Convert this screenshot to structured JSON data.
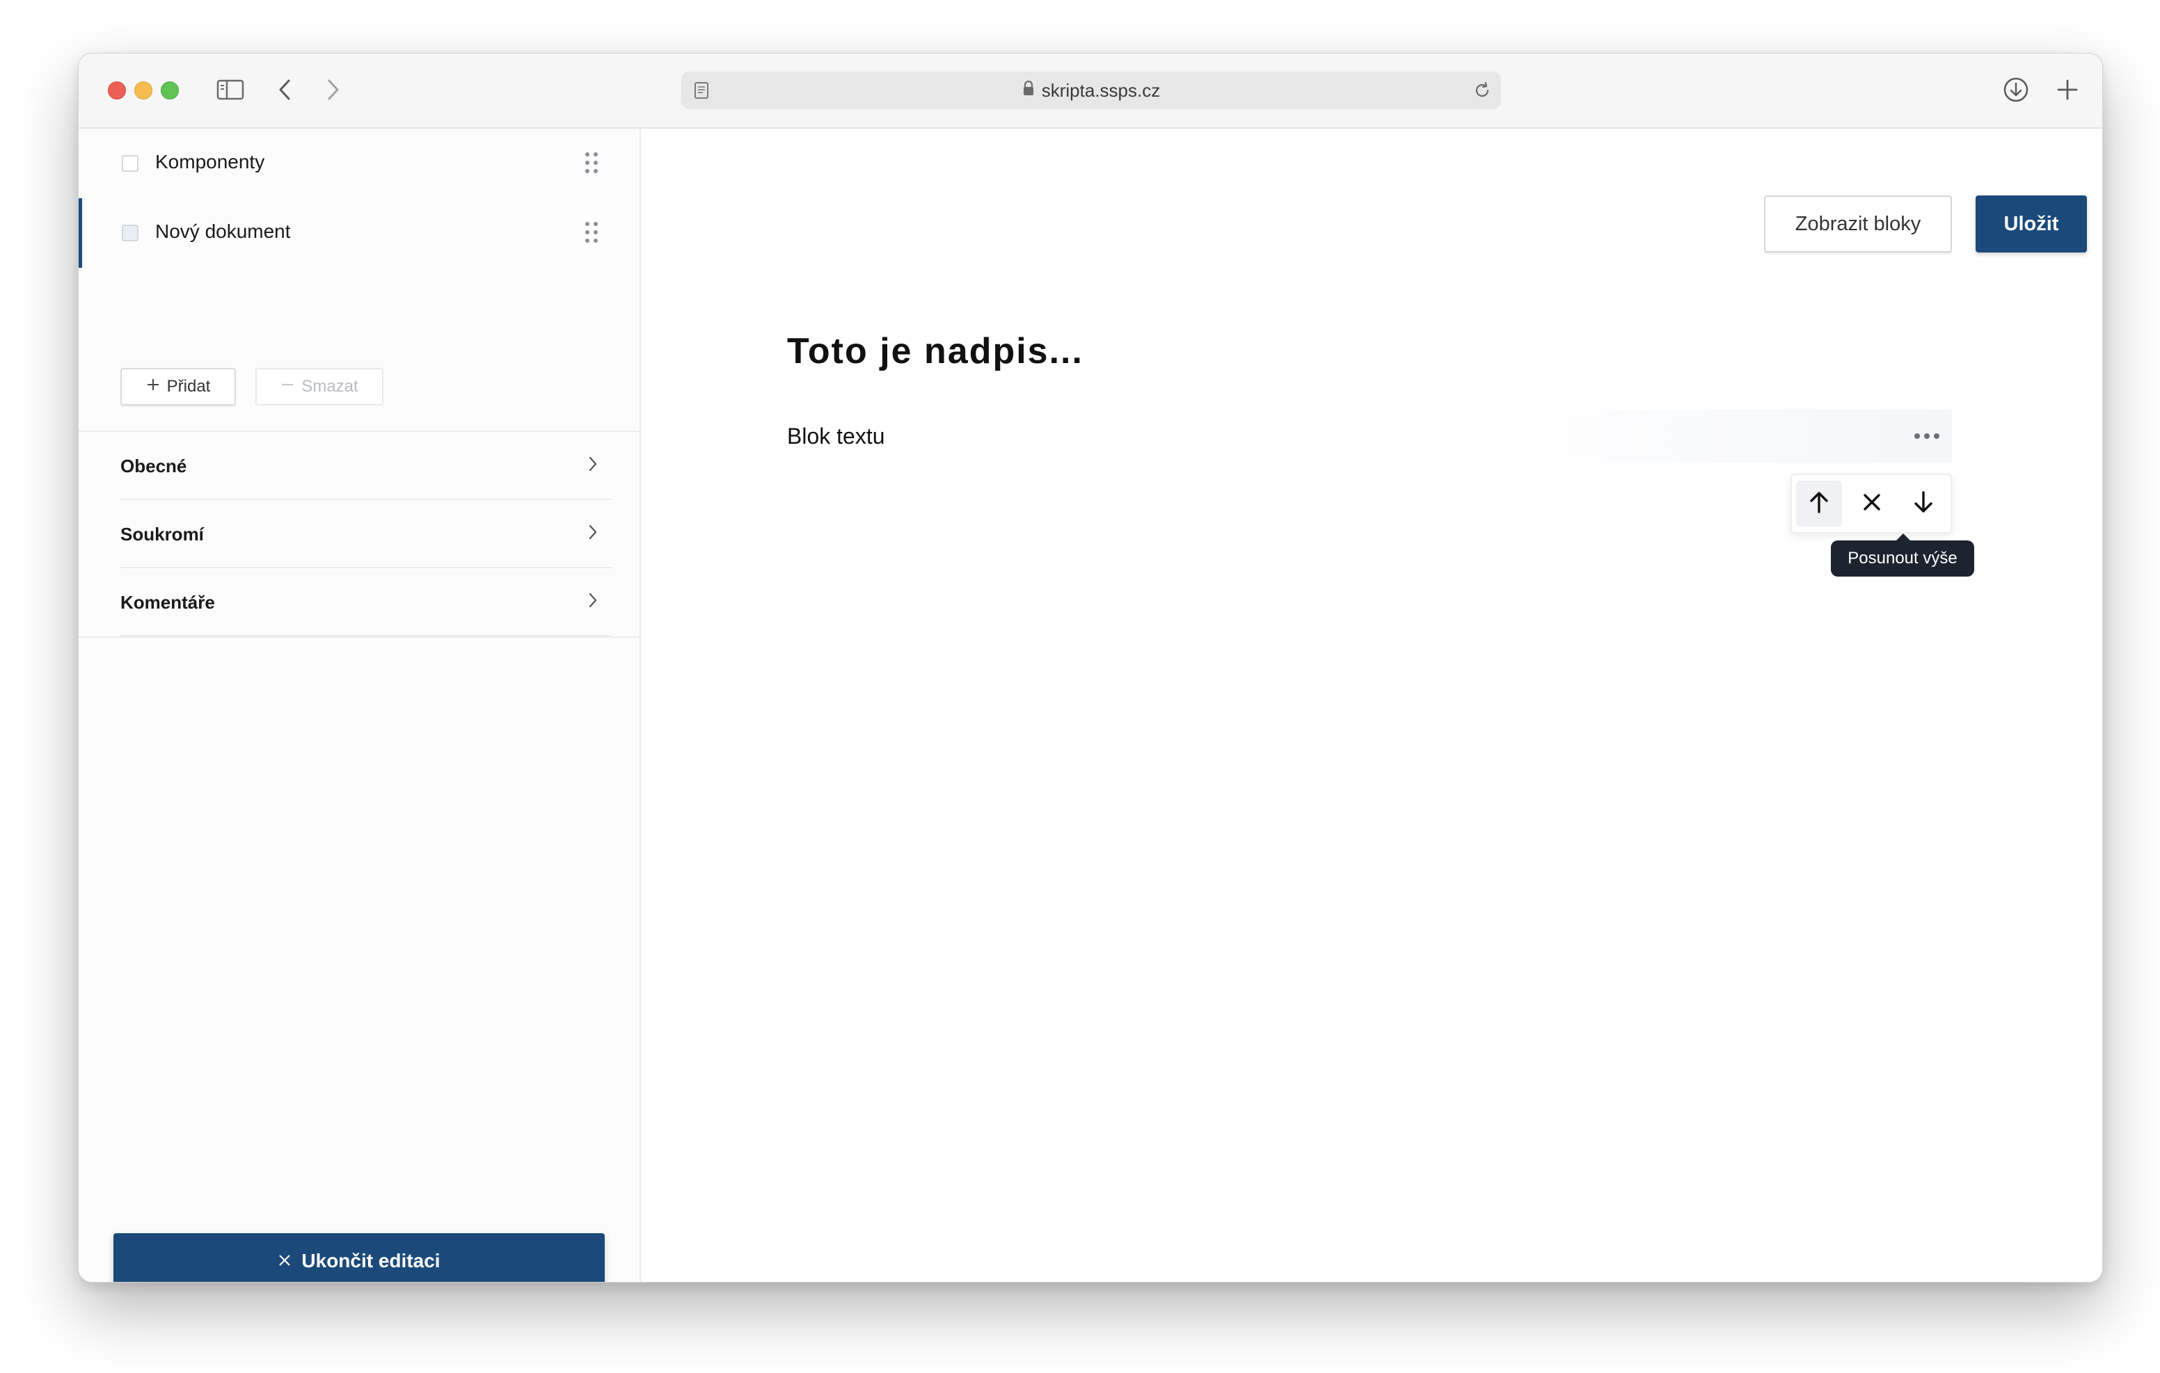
{
  "browser": {
    "url": "skripta.ssps.cz",
    "icons": [
      "sidebar-toggle-icon",
      "back-icon",
      "forward-icon",
      "page-icon",
      "lock-icon",
      "reload-icon",
      "download-icon",
      "new-tab-icon"
    ]
  },
  "sidebar": {
    "documents": [
      {
        "label": "Komponenty",
        "active": false
      },
      {
        "label": "Nový dokument",
        "active": true
      }
    ],
    "add_label": "Přidat",
    "delete_label": "Smazat",
    "sections": [
      {
        "label": "Obecné"
      },
      {
        "label": "Soukromí"
      },
      {
        "label": "Komentáře"
      }
    ],
    "exit_label": "Ukončit editaci"
  },
  "toolbar": {
    "show_blocks_label": "Zobrazit bloky",
    "save_label": "Uložit"
  },
  "document": {
    "heading": "Toto je nadpis...",
    "block_text": "Blok textu"
  },
  "block_actions": {
    "tooltip": "Posunout výše",
    "icons": [
      "arrow-up-icon",
      "close-icon",
      "arrow-down-icon"
    ]
  },
  "colors": {
    "accent": "#1b4a7a",
    "tooltip_bg": "#1e2330"
  }
}
